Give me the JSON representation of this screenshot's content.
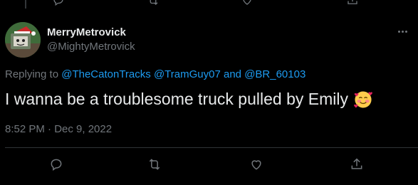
{
  "author": {
    "display_name": "MerryMetrovick",
    "handle": "@MightyMetrovick"
  },
  "reply_context": {
    "prefix": "Replying to ",
    "mention_1": "@TheCatonTracks",
    "mention_2": "@TramGuy07",
    "joiner": " and ",
    "mention_3": "@BR_60103"
  },
  "tweet": {
    "text": "I wanna be a troublesome truck pulled by Emily",
    "emoji": "smiling-face-with-hearts"
  },
  "meta": {
    "timestamp": "8:52 PM · Dec 9, 2022"
  },
  "colors": {
    "background": "#000000",
    "text_primary": "#e7e9ea",
    "text_secondary": "#71767b",
    "link": "#1d9bf0",
    "divider": "#2f3336"
  },
  "actions": {
    "icons": [
      "reply-icon",
      "retweet-icon",
      "like-icon",
      "share-icon"
    ]
  }
}
